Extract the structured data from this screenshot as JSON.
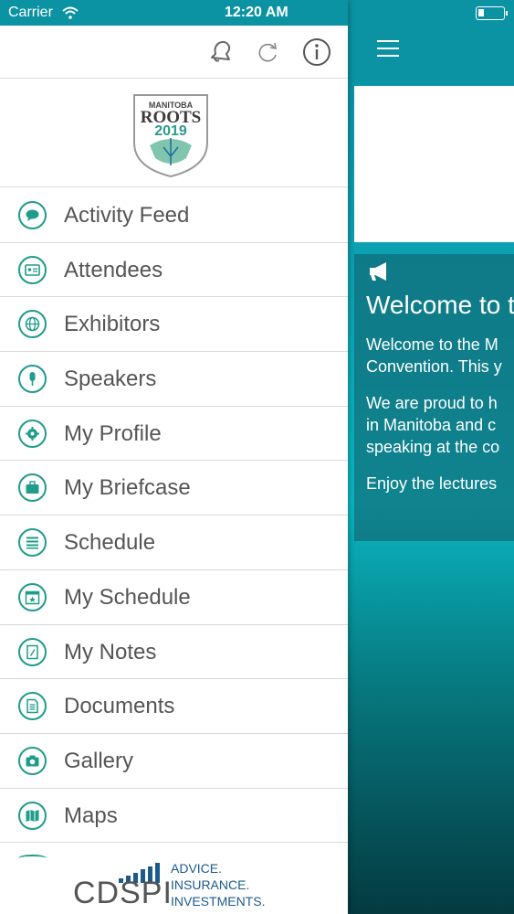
{
  "status": {
    "carrier": "Carrier",
    "time": "12:20 AM"
  },
  "toolbar": {
    "icons": [
      "bell-icon",
      "refresh-icon",
      "info-icon"
    ]
  },
  "logo": {
    "line1": "MANITOBA",
    "line2": "ROOTS",
    "line3": "2019"
  },
  "menu": [
    {
      "label": "Activity Feed",
      "icon": "chat-bubble-icon"
    },
    {
      "label": "Attendees",
      "icon": "id-card-icon"
    },
    {
      "label": "Exhibitors",
      "icon": "globe-icon"
    },
    {
      "label": "Speakers",
      "icon": "microphone-icon"
    },
    {
      "label": "My Profile",
      "icon": "gear-icon"
    },
    {
      "label": "My Briefcase",
      "icon": "briefcase-icon"
    },
    {
      "label": "Schedule",
      "icon": "list-icon"
    },
    {
      "label": "My Schedule",
      "icon": "calendar-star-icon"
    },
    {
      "label": "My Notes",
      "icon": "note-pencil-icon"
    },
    {
      "label": "Documents",
      "icon": "document-icon"
    },
    {
      "label": "Gallery",
      "icon": "camera-icon"
    },
    {
      "label": "Maps",
      "icon": "map-icon"
    }
  ],
  "sponsor": {
    "name": "CDSPI",
    "tag1": "ADVICE.",
    "tag2": "INSURANCE.",
    "tag3": "INVESTMENTS."
  },
  "main": {
    "title": "Welcome to t",
    "p1_line1": "Welcome to the M",
    "p1_line2": "Convention. This y",
    "p2_line1": "We are proud to h",
    "p2_line2": "in Manitoba and c",
    "p2_line3": "speaking at the co",
    "p3_line1": "Enjoy the lectures"
  },
  "colors": {
    "accent": "#1f9c8c",
    "header": "#0b93a3"
  }
}
